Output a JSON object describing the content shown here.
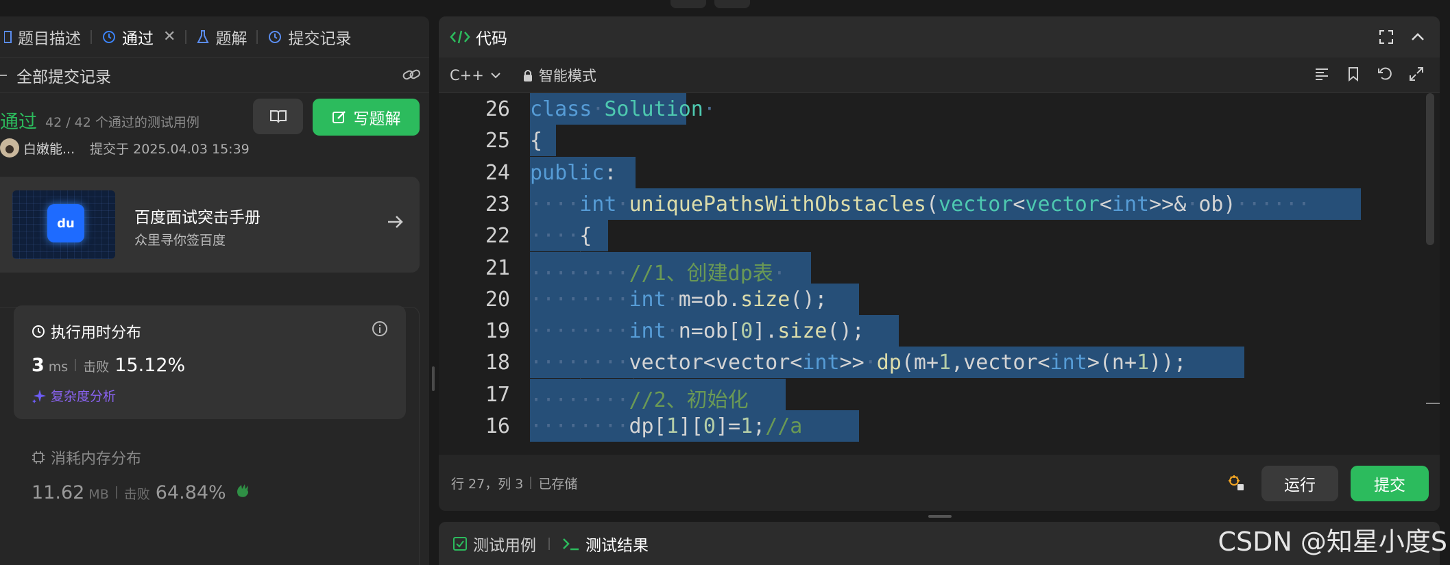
{
  "left": {
    "tabs": [
      {
        "label": "题目描述"
      },
      {
        "label": "通过"
      },
      {
        "label": "题解"
      },
      {
        "label": "提交记录"
      }
    ],
    "all_submissions": "全部提交记录",
    "status": "通过",
    "cases": "42 / 42 个通过的测试用例",
    "user": "白嫩能...",
    "submitted_at": "提交于 2025.04.03 15:39",
    "write_solution": "写题解",
    "promo_title": "百度面试突击手册",
    "promo_sub": "众里寻你签百度",
    "promo_logo": "du",
    "runtime_title": "执行用时分布",
    "runtime_value": "3",
    "runtime_unit": "ms",
    "beats_label": "击败",
    "runtime_beats": "15.12%",
    "complexity": "复杂度分析",
    "memory_title": "消耗内存分布",
    "memory_value": "11.62",
    "memory_unit": "MB",
    "memory_beats": "64.84%"
  },
  "code": {
    "title": "代码",
    "language": "C++",
    "mode": "智能模式",
    "status": "行 27，列 3",
    "saved": "已存储",
    "run": "运行",
    "submit": "提交",
    "lines": [
      {
        "num": "26",
        "html": "<span class='kw'>class</span><span class='ws'>·</span><span class='ty'>Solution</span><span class='ws'>·</span>",
        "sel": 228
      },
      {
        "num": "25",
        "html": "{",
        "sel": 38
      },
      {
        "num": "24",
        "html": "<span class='kw'>public</span>:",
        "sel": 154
      },
      {
        "num": "23",
        "html": "<span class='ws'>····</span><span class='kw'>int</span><span class='ws'>·</span><span class='fn'>uniquePathsWithObstacles</span>(<span class='ty'>vector</span>&lt;<span class='ty'>vector</span>&lt;<span class='kw'>int</span>&gt;&gt;&amp;<span class='ws'>·</span>ob)<span class='ws'>······</span>",
        "sel": 1212
      },
      {
        "num": "22",
        "html": "<span class='ws'>····</span>{",
        "sel": 114
      },
      {
        "num": "21",
        "html": "<span class='ws'>········</span><span class='cm'>//1、创建dp表</span><span class='ws'>·</span>",
        "sel": 410
      },
      {
        "num": "20",
        "html": "<span class='ws'>········</span><span class='kw'>int</span><span class='ws'>·</span>m=ob.<span class='fn'>size</span>();",
        "sel": 480
      },
      {
        "num": "19",
        "html": "<span class='ws'>········</span><span class='kw'>int</span><span class='ws'>·</span>n=ob[<span class='num'>0</span>].<span class='fn'>size</span>();",
        "sel": 538
      },
      {
        "num": "18",
        "html": "<span class='ws'>········</span>vector&lt;vector&lt;<span class='kw'>int</span>&gt;&gt;<span class='ws'>·</span><span class='fn'>dp</span>(m+<span class='num'>1</span>,vector&lt;<span class='kw'>int</span>&gt;(n+<span class='num'>1</span>));",
        "sel": 1042
      },
      {
        "num": "17",
        "html": "<span class='ws'>········</span><span class='cm'>//2、初始化</span>",
        "sel": 373
      },
      {
        "num": "16",
        "html": "<span class='ws'>········</span>dp[<span class='num'>1</span>][<span class='num'>0</span>]=<span class='num'>1</span>;<span class='cm'>//a</span>",
        "sel": 480
      }
    ]
  },
  "bottom": {
    "testcase": "测试用例",
    "testresult": "测试结果"
  },
  "watermark": "CSDN @知星小度S"
}
